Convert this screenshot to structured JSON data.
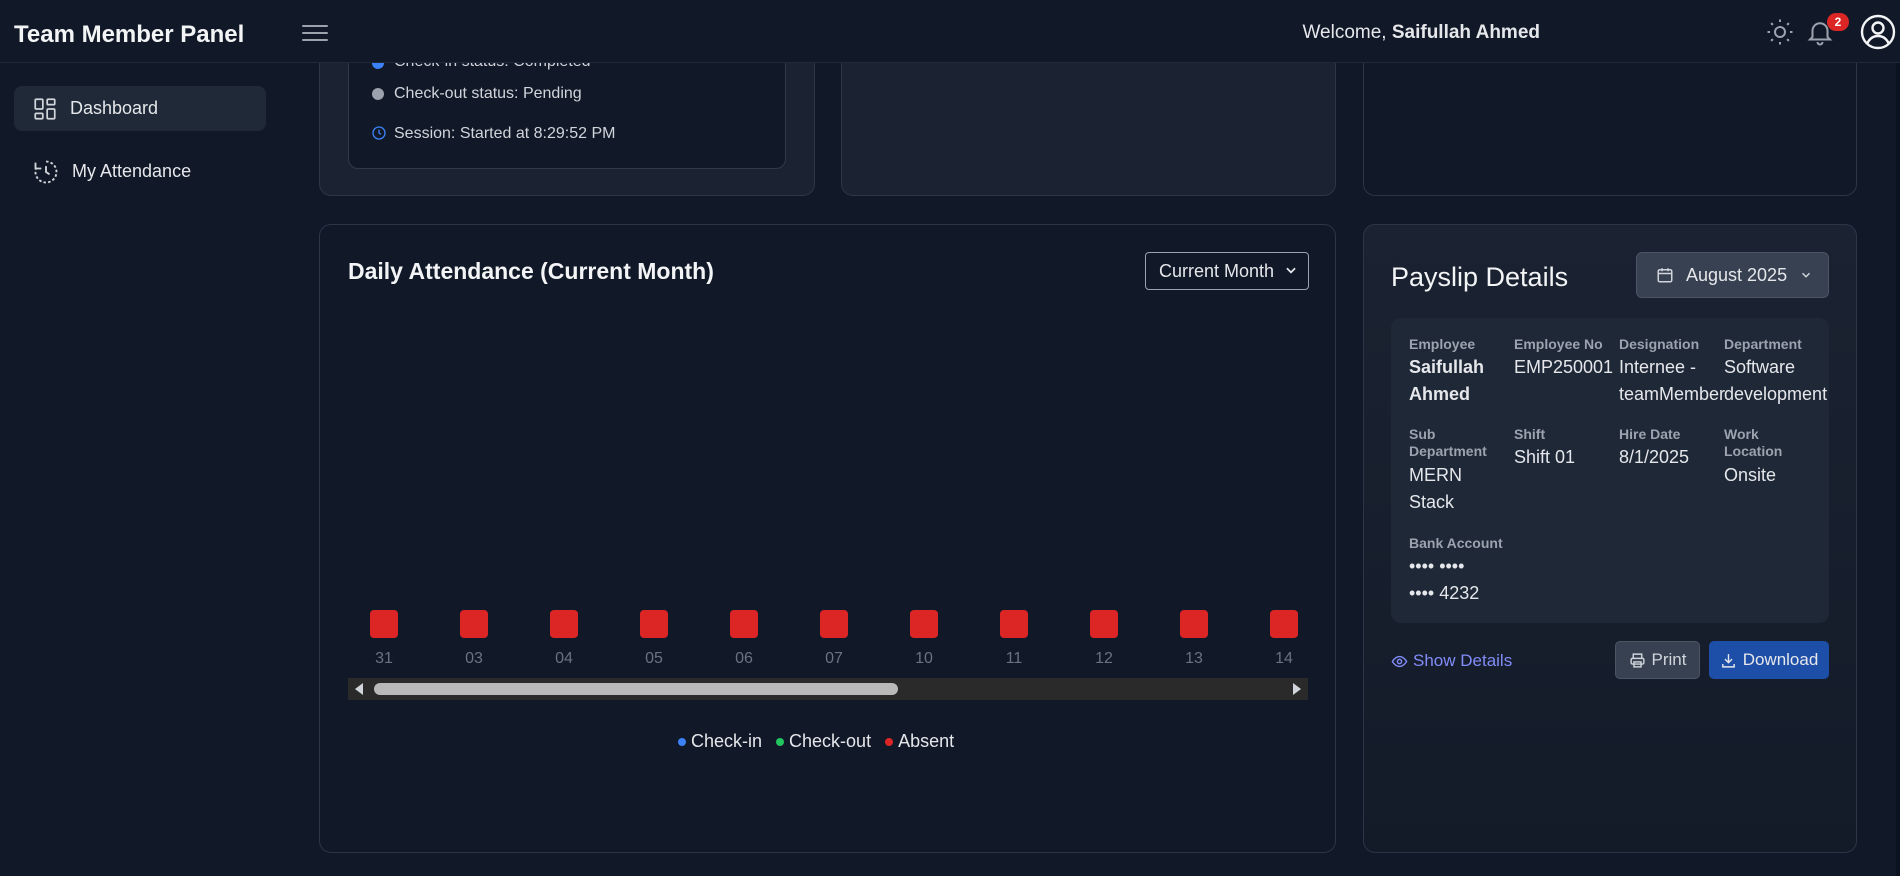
{
  "header": {
    "brand": "Team Member Panel",
    "welcome_prefix": "Welcome,",
    "user_name": "Saifullah Ahmed",
    "notification_count": "2",
    "icons": [
      "menu-icon",
      "sun-icon",
      "bell-icon",
      "user-icon"
    ]
  },
  "sidebar": {
    "items": [
      {
        "label": "Dashboard",
        "icon": "dashboard-icon",
        "active": true
      },
      {
        "label": "My Attendance",
        "icon": "clock-history-icon",
        "active": false
      }
    ]
  },
  "status": {
    "checkin": "Check-in status: Completed",
    "checkout": "Check-out status: Pending",
    "session": "Session: Started at 8:29:52 PM"
  },
  "attendance": {
    "title": "Daily Attendance (Current Month)",
    "filter_value": "Current Month"
  },
  "chart_data": {
    "type": "bar",
    "title": "Daily Attendance (Current Month)",
    "categories": [
      "31",
      "03",
      "04",
      "05",
      "06",
      "07",
      "10",
      "11",
      "12",
      "13",
      "14"
    ],
    "series": [
      {
        "name": "Check-in",
        "color": "#3b82f6",
        "values": [
          0,
          0,
          0,
          0,
          0,
          0,
          0,
          0,
          0,
          0,
          0
        ]
      },
      {
        "name": "Check-out",
        "color": "#22c55e",
        "values": [
          0,
          0,
          0,
          0,
          0,
          0,
          0,
          0,
          0,
          0,
          0
        ]
      },
      {
        "name": "Absent",
        "color": "#dc2626",
        "values": [
          1,
          1,
          1,
          1,
          1,
          1,
          1,
          1,
          1,
          1,
          1
        ]
      }
    ],
    "legend": "bottom",
    "grid": false
  },
  "payslip": {
    "title": "Payslip Details",
    "month": "August 2025",
    "fields": {
      "employee": {
        "label": "Employee",
        "value": "Saifullah Ahmed"
      },
      "employee_no": {
        "label": "Employee No",
        "value": "EMP250001"
      },
      "designation": {
        "label": "Designation",
        "value": "Internee - teamMember"
      },
      "department": {
        "label": "Department",
        "value": "Software development"
      },
      "sub_department": {
        "label": "Sub Department",
        "value": "MERN Stack"
      },
      "shift": {
        "label": "Shift",
        "value": "Shift 01"
      },
      "hire_date": {
        "label": "Hire Date",
        "value": "8/1/2025"
      },
      "work_location": {
        "label": "Work Location",
        "value": "Onsite"
      },
      "bank_account": {
        "label": "Bank Account",
        "value": "•••• •••• •••• 4232"
      }
    },
    "show_details": "Show Details",
    "print": "Print",
    "download": "Download"
  }
}
